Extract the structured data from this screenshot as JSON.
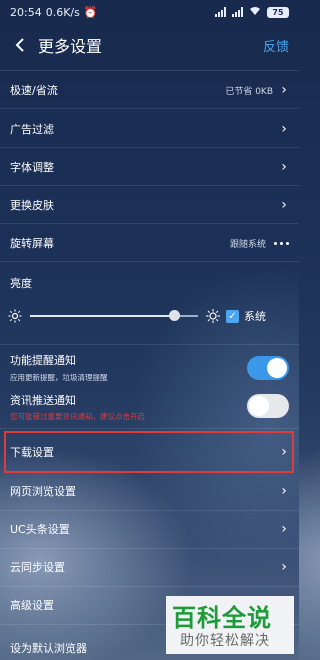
{
  "status": {
    "time": "20:54",
    "speed": "0.6K/s",
    "battery": "75"
  },
  "header": {
    "back_icon": "chevron-left-icon",
    "title": "更多设置",
    "feedback": "反馈"
  },
  "settings": {
    "speed_mode": {
      "label": "极速/省流",
      "value": "已节省 0KB"
    },
    "ad_filter": {
      "label": "广告过滤"
    },
    "font_adjust": {
      "label": "字体调整"
    },
    "skin": {
      "label": "更换皮肤"
    },
    "rotate": {
      "label": "旋转屏幕",
      "value": "跟随系统"
    },
    "brightness": {
      "label": "亮度",
      "level": 0.86,
      "follow_system_label": "系统",
      "follow_system_checked": true
    },
    "feature_notice": {
      "label": "功能提醒通知",
      "sub": "应用更新提醒，垃圾清理提醒",
      "on": true
    },
    "news_push": {
      "label": "资讯推送通知",
      "sub": "您可能错过重要资讯通知，建议点击开启",
      "on": false
    },
    "download": {
      "label": "下载设置"
    },
    "web_browse": {
      "label": "网页浏览设置"
    },
    "uc_headline": {
      "label": "UC头条设置"
    },
    "cloud_sync": {
      "label": "云同步设置"
    },
    "advanced": {
      "label": "高级设置"
    },
    "default_browser": {
      "label": "设为默认浏览器"
    }
  },
  "watermark": {
    "top": "百科全说",
    "bottom": "助你轻松解决"
  },
  "colors": {
    "accent": "#3b98e8",
    "highlight": "#e03b3b",
    "warning": "#e0393c",
    "watermark_green": "#1f9a3a"
  }
}
